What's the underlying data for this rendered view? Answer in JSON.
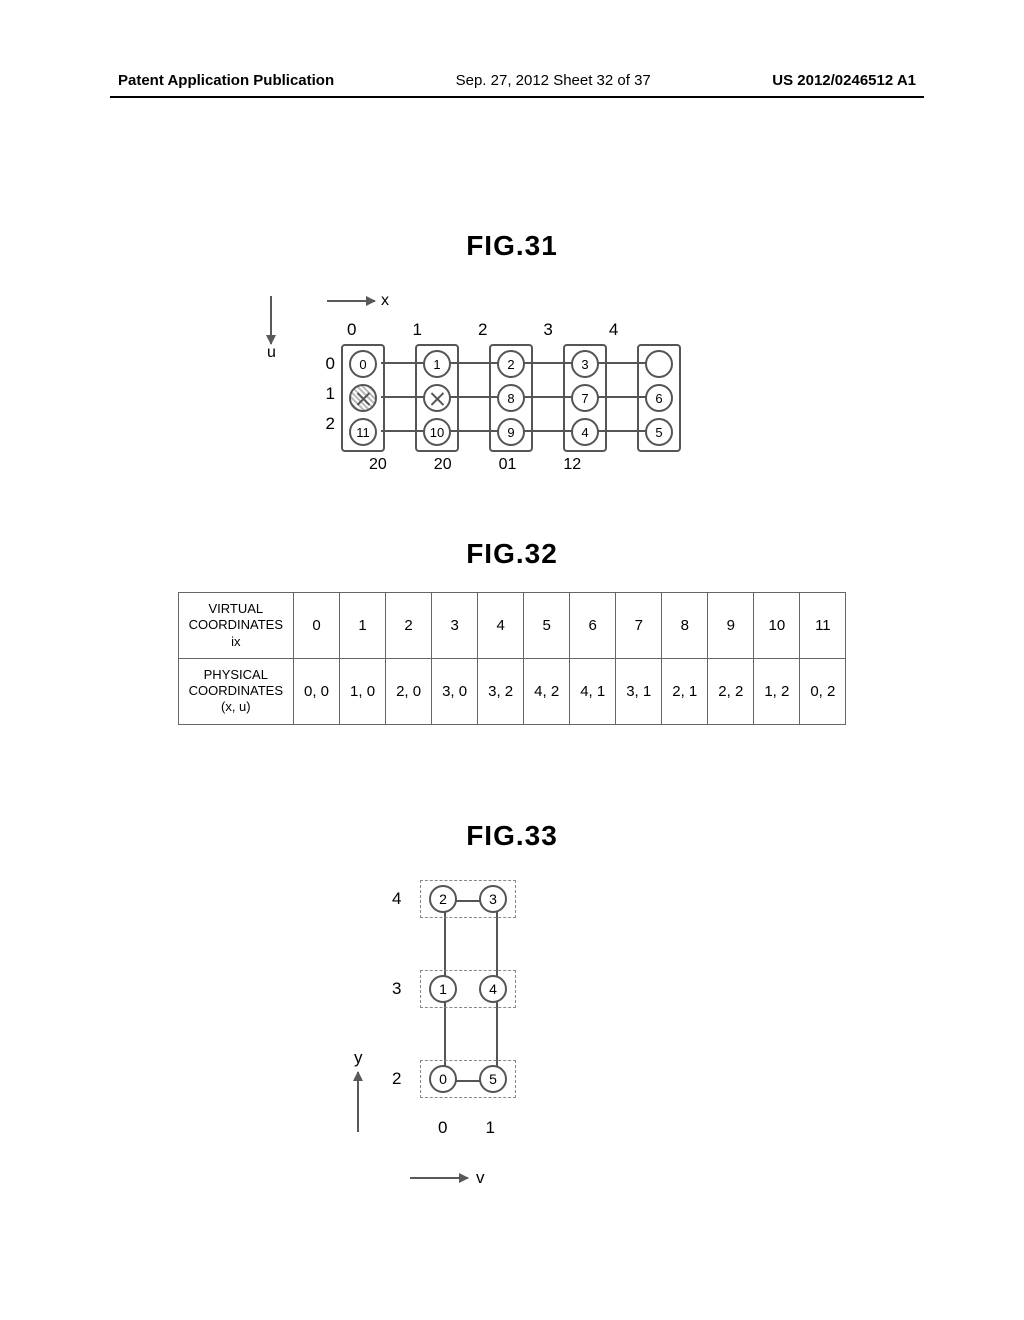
{
  "header": {
    "left": "Patent Application Publication",
    "center": "Sep. 27, 2012  Sheet 32 of 37",
    "right": "US 2012/0246512 A1"
  },
  "fig31": {
    "title": "FIG.31",
    "x_axis": "x",
    "u_axis": "u",
    "col_headers": [
      "0",
      "1",
      "2",
      "3",
      "4"
    ],
    "row_headers": [
      "0",
      "1",
      "2"
    ],
    "columns": [
      [
        {
          "label": "0"
        },
        {
          "label": "",
          "failed": true,
          "shaded": true
        },
        {
          "label": "11"
        }
      ],
      [
        {
          "label": "1"
        },
        {
          "label": "",
          "failed": true
        },
        {
          "label": "10"
        }
      ],
      [
        {
          "label": "2"
        },
        {
          "label": "8"
        },
        {
          "label": "9"
        }
      ],
      [
        {
          "label": "3"
        },
        {
          "label": "7"
        },
        {
          "label": "4"
        }
      ],
      [
        {
          "label": ""
        },
        {
          "label": "6"
        },
        {
          "label": "5"
        }
      ]
    ],
    "bottom_labels": [
      "20",
      "20",
      "01",
      "12"
    ]
  },
  "fig32": {
    "title": "FIG.32",
    "row1_header": "VIRTUAL\nCOORDINATES\nix",
    "row2_header": "PHYSICAL\nCOORDINATES\n(x, u)",
    "virtual": [
      "0",
      "1",
      "2",
      "3",
      "4",
      "5",
      "6",
      "7",
      "8",
      "9",
      "10",
      "11"
    ],
    "physical": [
      "0, 0",
      "1, 0",
      "2, 0",
      "3, 0",
      "3, 2",
      "4, 2",
      "4, 1",
      "3, 1",
      "2, 1",
      "2, 2",
      "1, 2",
      "0, 2"
    ]
  },
  "fig33": {
    "title": "FIG.33",
    "y_axis": "y",
    "v_axis": "v",
    "row_headers": [
      "4",
      "3",
      "2"
    ],
    "col_headers": [
      "0",
      "1"
    ],
    "rows": [
      [
        "2",
        "3"
      ],
      [
        "1",
        "4"
      ],
      [
        "0",
        "5"
      ]
    ]
  },
  "chart_data": [
    {
      "type": "diagram",
      "figure": "FIG.31",
      "description": "5×3 grid of nodes (columns x=0..4 in boxes, rows u=0..2). Two failed nodes at (0,1) shaded+X and (1,1) X. Horizontal links between adjacent columns at each row. Bottom labels between columns: 20,20,01,12.",
      "nodes": [
        {
          "x": 0,
          "u": 0,
          "label": 0
        },
        {
          "x": 0,
          "u": 1,
          "label": null,
          "failed": true,
          "shaded": true
        },
        {
          "x": 0,
          "u": 2,
          "label": 11
        },
        {
          "x": 1,
          "u": 0,
          "label": 1
        },
        {
          "x": 1,
          "u": 1,
          "label": null,
          "failed": true
        },
        {
          "x": 1,
          "u": 2,
          "label": 10
        },
        {
          "x": 2,
          "u": 0,
          "label": 2
        },
        {
          "x": 2,
          "u": 1,
          "label": 8
        },
        {
          "x": 2,
          "u": 2,
          "label": 9
        },
        {
          "x": 3,
          "u": 0,
          "label": 3
        },
        {
          "x": 3,
          "u": 1,
          "label": 7
        },
        {
          "x": 3,
          "u": 2,
          "label": 4
        },
        {
          "x": 4,
          "u": 0,
          "label": null
        },
        {
          "x": 4,
          "u": 1,
          "label": 6
        },
        {
          "x": 4,
          "u": 2,
          "label": 5
        }
      ],
      "gap_labels": [
        "20",
        "20",
        "01",
        "12"
      ]
    },
    {
      "type": "table",
      "figure": "FIG.32",
      "columns": [
        "ix",
        "(x,u)"
      ],
      "rows": [
        [
          0,
          "0,0"
        ],
        [
          1,
          "1,0"
        ],
        [
          2,
          "2,0"
        ],
        [
          3,
          "3,0"
        ],
        [
          4,
          "3,2"
        ],
        [
          5,
          "4,2"
        ],
        [
          6,
          "4,1"
        ],
        [
          7,
          "3,1"
        ],
        [
          8,
          "2,1"
        ],
        [
          9,
          "2,2"
        ],
        [
          10,
          "1,2"
        ],
        [
          11,
          "0,2"
        ]
      ]
    },
    {
      "type": "diagram",
      "figure": "FIG.33",
      "description": "2×3 node grid in dashed row-boxes; columns v=0..1 bottom, rows y=2..4 ascending. Horizontal edge 2–3 top, 0–5 bottom; vertical edges 2–1–0 and 3–4–5.",
      "nodes": [
        {
          "v": 0,
          "y": 4,
          "label": 2
        },
        {
          "v": 1,
          "y": 4,
          "label": 3
        },
        {
          "v": 0,
          "y": 3,
          "label": 1
        },
        {
          "v": 1,
          "y": 3,
          "label": 4
        },
        {
          "v": 0,
          "y": 2,
          "label": 0
        },
        {
          "v": 1,
          "y": 2,
          "label": 5
        }
      ],
      "edges": [
        [
          "2",
          "3"
        ],
        [
          "0",
          "5"
        ],
        [
          "2",
          "1"
        ],
        [
          "1",
          "0"
        ],
        [
          "3",
          "4"
        ],
        [
          "4",
          "5"
        ]
      ]
    }
  ]
}
